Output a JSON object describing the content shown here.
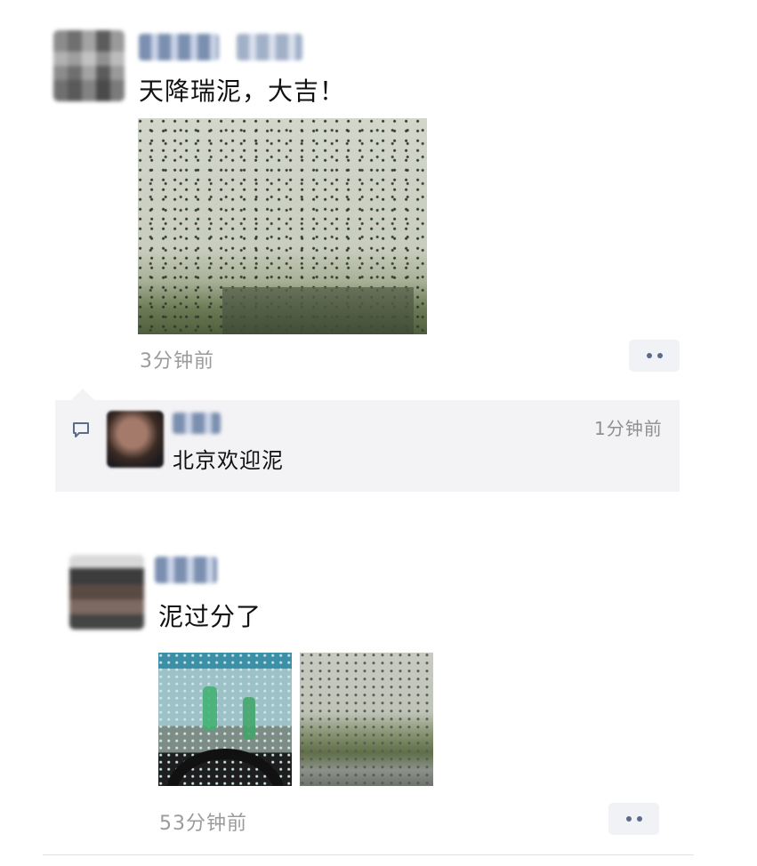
{
  "post1": {
    "text": "天降瑞泥，大吉！",
    "time": "3分钟前",
    "comment": {
      "text": "北京欢迎泥",
      "time": "1分钟前"
    }
  },
  "post2": {
    "text": "泥过分了",
    "time": "53分钟前"
  },
  "icons": {
    "more": "more-dots-icon",
    "comment": "comment-bubble-icon"
  },
  "colors": {
    "link_blue": "#5b6b8c",
    "time_gray": "#9b9b9b",
    "comment_bg": "#f3f3f5"
  }
}
